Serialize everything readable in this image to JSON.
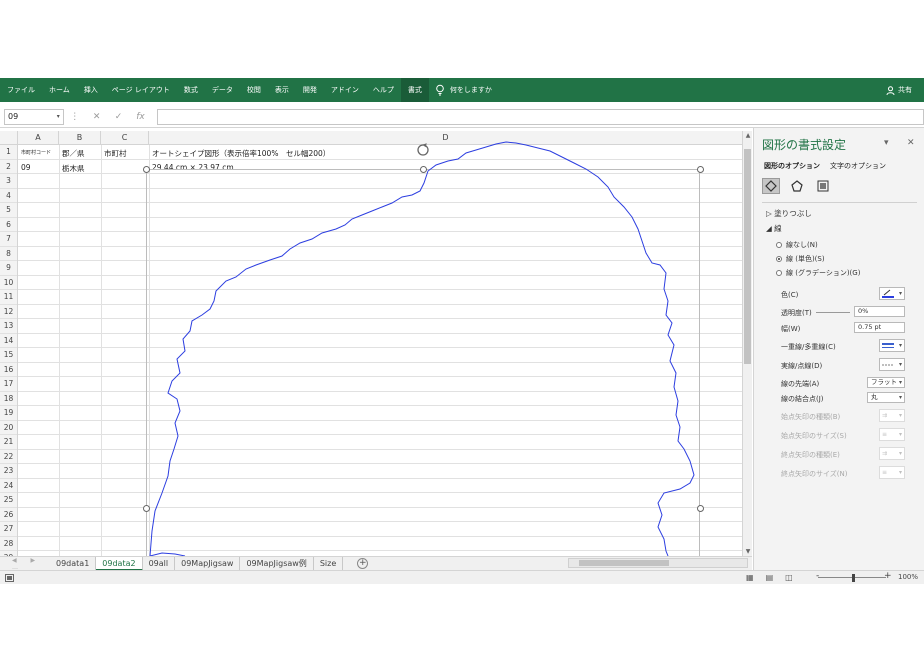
{
  "ribbon": {
    "tabs": [
      "ファイル",
      "ホーム",
      "挿入",
      "ページ レイアウト",
      "数式",
      "データ",
      "校閲",
      "表示",
      "開発",
      "アドイン",
      "ヘルプ",
      "書式"
    ],
    "active_tab": "書式",
    "tell_me": "何をしますか",
    "share": "共有"
  },
  "formula_bar": {
    "name_box": "09",
    "fx": "fx",
    "value": ""
  },
  "columns": [
    "A",
    "B",
    "C",
    "D"
  ],
  "rows": [
    "1",
    "2",
    "3",
    "4",
    "5",
    "6",
    "7",
    "8",
    "9",
    "10",
    "11",
    "12",
    "13",
    "14",
    "15",
    "16",
    "17",
    "18",
    "19",
    "20",
    "21",
    "22",
    "23",
    "24",
    "25",
    "26",
    "27",
    "28",
    "29"
  ],
  "cells": {
    "a1": "市町村コード",
    "b1": "郡／県",
    "c1": "市町村",
    "d1": "オートシェイプ図形（表示倍率100%　セル幅200）",
    "a2": "09",
    "b2": "栃木県",
    "d2": "29.44 cm × 23.97 cm"
  },
  "sheets": {
    "tabs": [
      "09data1",
      "09data2",
      "09all",
      "09MapJigsaw",
      "09MapJigsaw例",
      "Size"
    ],
    "active": "09data2"
  },
  "status": {
    "zoom": "100%"
  },
  "panel": {
    "title": "図形の書式設定",
    "tab_shape": "図形のオプション",
    "tab_text": "文字のオプション",
    "fill_section": "塗りつぶし",
    "line_section": "線",
    "radio_none": "線なし(N)",
    "radio_solid": "線 (単色)(S)",
    "radio_gradient": "線 (グラデーション)(G)",
    "color": "色(C)",
    "transparency": "透明度(T)",
    "transparency_value": "0%",
    "width": "幅(W)",
    "width_value": "0.75 pt",
    "compound": "一重線/多重線(C)",
    "dash": "実線/点線(D)",
    "cap": "線の先端(A)",
    "cap_value": "フラット",
    "join": "線の結合点(J)",
    "join_value": "丸",
    "begin_arrow_type": "始点矢印の種類(B)",
    "begin_arrow_size": "始点矢印のサイズ(S)",
    "end_arrow_type": "終点矢印の種類(E)",
    "end_arrow_size": "終点矢印のサイズ(N)"
  },
  "colors": {
    "ribbon": "#217346",
    "shape_line": "#2c3ee0"
  }
}
